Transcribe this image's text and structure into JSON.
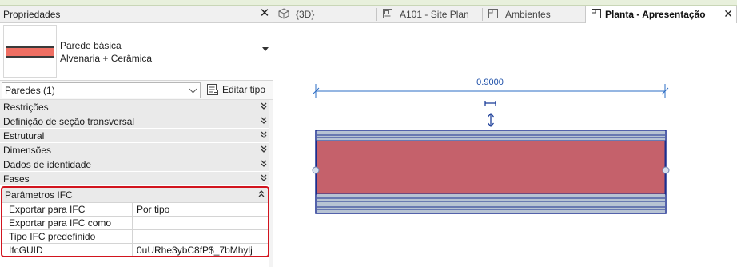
{
  "properties": {
    "title": "Propriedades",
    "type_selector": {
      "name": "Parede básica",
      "subtype": "Alvenaria + Cerâmica"
    },
    "filter": {
      "selected": "Paredes (1)",
      "edit_type_label": "Editar tipo"
    },
    "sections": [
      {
        "label": "Restrições"
      },
      {
        "label": "Definição de seção transversal"
      },
      {
        "label": "Estrutural"
      },
      {
        "label": "Dimensões"
      },
      {
        "label": "Dados de identidade"
      },
      {
        "label": "Fases"
      }
    ],
    "ifc": {
      "label": "Parâmetros IFC",
      "params": [
        {
          "name": "Exportar para IFC",
          "value": "Por tipo"
        },
        {
          "name": "Exportar para IFC como",
          "value": ""
        },
        {
          "name": "Tipo IFC predefinido",
          "value": ""
        },
        {
          "name": "IfcGUID",
          "value": "0uURhe3ybC8fP$_7bMhylj"
        }
      ]
    }
  },
  "tabs": [
    {
      "label": "{3D}",
      "icon": "3d-view-icon",
      "active": false
    },
    {
      "label": "A101 - Site Plan",
      "icon": "sheet-icon",
      "active": false
    },
    {
      "label": "Ambientes",
      "icon": "floor-plan-icon",
      "active": false
    },
    {
      "label": "Planta - Apresentação",
      "icon": "floor-plan-icon",
      "active": true
    }
  ],
  "view": {
    "dimension_label": "0.9000",
    "colors": {
      "wall_fill": "#c5616b",
      "wall_edge": "#1b2f8f",
      "finish_layer": "#b7c3d3",
      "dimension": "#2b6cc4"
    }
  }
}
